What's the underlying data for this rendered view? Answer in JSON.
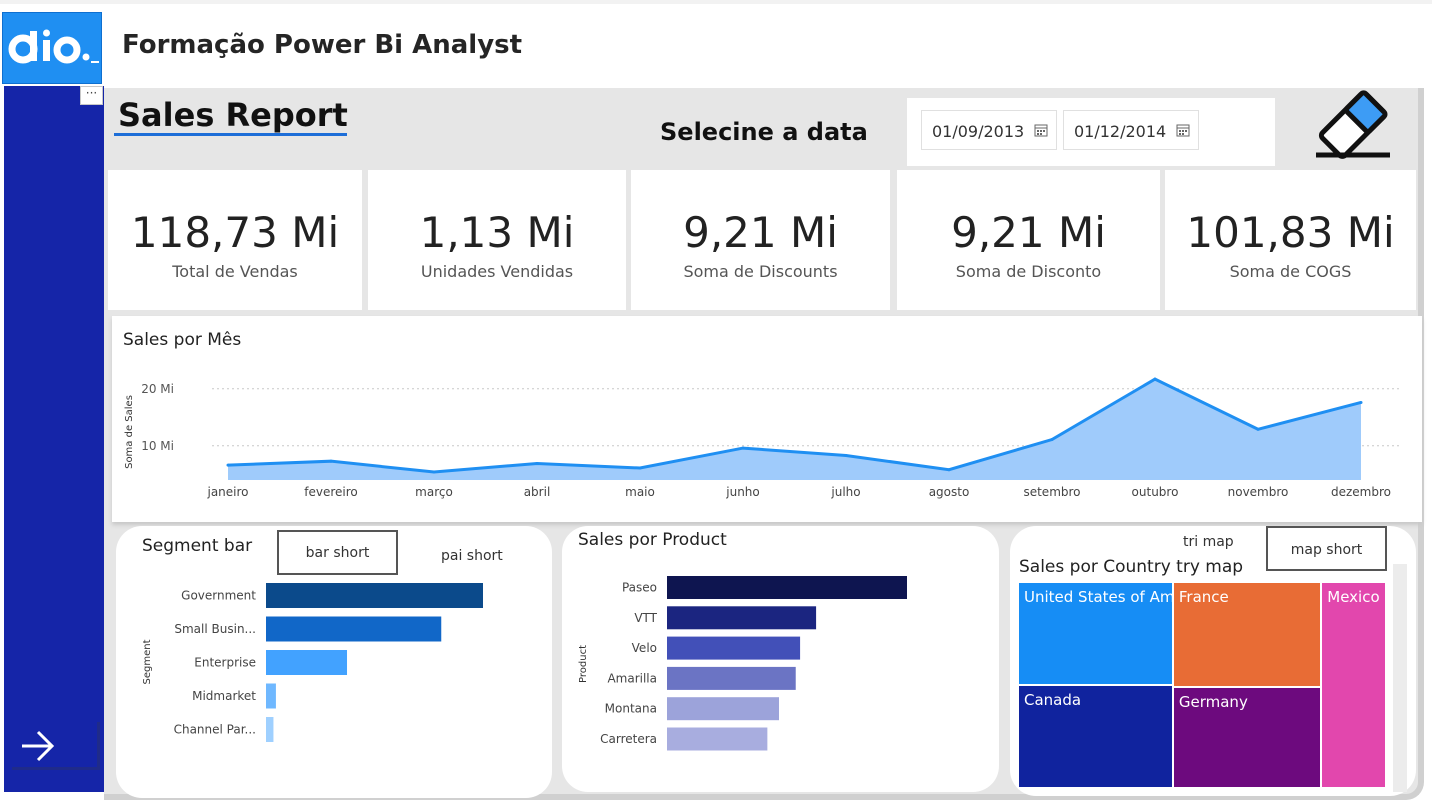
{
  "app": {
    "title": "Formação Power Bi Analyst"
  },
  "report": {
    "title": "Sales Report"
  },
  "date_filter": {
    "label": "Selecine a data",
    "start": "01/09/2013",
    "end": "01/12/2014"
  },
  "kpis": [
    {
      "value": "118,73 Mi",
      "label": "Total de Vendas"
    },
    {
      "value": "1,13 Mi",
      "label": "Unidades Vendidas"
    },
    {
      "value": "9,21 Mi",
      "label": "Soma de Discounts"
    },
    {
      "value": "9,21 Mi",
      "label": "Soma de Disconto"
    },
    {
      "value": "101,83 Mi",
      "label": "Soma de COGS"
    }
  ],
  "icons": {
    "logo": "dio-logo",
    "more": "more-options-icon",
    "next": "arrow-right-icon",
    "eraser": "eraser-icon",
    "calendar": "calendar-icon"
  },
  "colors": {
    "sidebar": "#1525a8",
    "logo_bg": "#1f8ff2",
    "accent": "#1d6ed8",
    "area_fill": "#9fcbfb",
    "area_line": "#1f8ff2"
  },
  "segment_panel": {
    "title": "Segment bar",
    "bar_button": "bar short",
    "pie_button": "pai short"
  },
  "product_panel": {
    "title": "Sales por Product"
  },
  "country_panel": {
    "title": "Sales por Country try map",
    "tri_button": "tri map",
    "map_button": "map short"
  },
  "chart_data": [
    {
      "type": "area",
      "title": "Sales por Mês",
      "xlabel": "",
      "ylabel": "Soma de Sales",
      "categories": [
        "janeiro",
        "fevereiro",
        "março",
        "abril",
        "maio",
        "junho",
        "julho",
        "agosto",
        "setembro",
        "outubro",
        "novembro",
        "dezembro"
      ],
      "values": [
        6.6,
        7.3,
        5.4,
        6.9,
        6.1,
        9.6,
        8.3,
        5.8,
        11.1,
        21.7,
        12.9,
        17.6
      ],
      "y_ticks": [
        "10 Mi",
        "20 Mi"
      ],
      "y_tick_values": [
        10,
        20
      ],
      "ylim": [
        4,
        24
      ],
      "grid": true
    },
    {
      "type": "bar",
      "orientation": "horizontal",
      "title": "",
      "ylabel": "Segment",
      "categories": [
        "Government",
        "Small Busin...",
        "Enterprise",
        "Midmarket",
        "Channel Par..."
      ],
      "values": [
        52.5,
        42.4,
        19.6,
        2.4,
        1.8
      ],
      "colors": [
        "#0b4a8b",
        "#1167c8",
        "#42a2ff",
        "#6fb8ff",
        "#9fd0ff"
      ]
    },
    {
      "type": "bar",
      "orientation": "horizontal",
      "title": "Sales por Product",
      "ylabel": "Product",
      "categories": [
        "Paseo",
        "VTT",
        "Velo",
        "Amarilla",
        "Montana",
        "Carretera"
      ],
      "values": [
        33.0,
        20.5,
        18.3,
        17.7,
        15.4,
        13.8
      ],
      "colors": [
        "#0e1550",
        "#1b2580",
        "#4250b8",
        "#6b74c4",
        "#9ca3da",
        "#a8addf"
      ]
    },
    {
      "type": "treemap",
      "title": "Sales por Country try map",
      "categories": [
        "United States of Am...",
        "France",
        "Mexico",
        "Canada",
        "Germany"
      ],
      "values": [
        25.0,
        24.4,
        20.9,
        25.0,
        23.5
      ],
      "colors": [
        "#168df5",
        "#e86c35",
        "#e247ad",
        "#10239e",
        "#6d0a7e"
      ]
    }
  ]
}
